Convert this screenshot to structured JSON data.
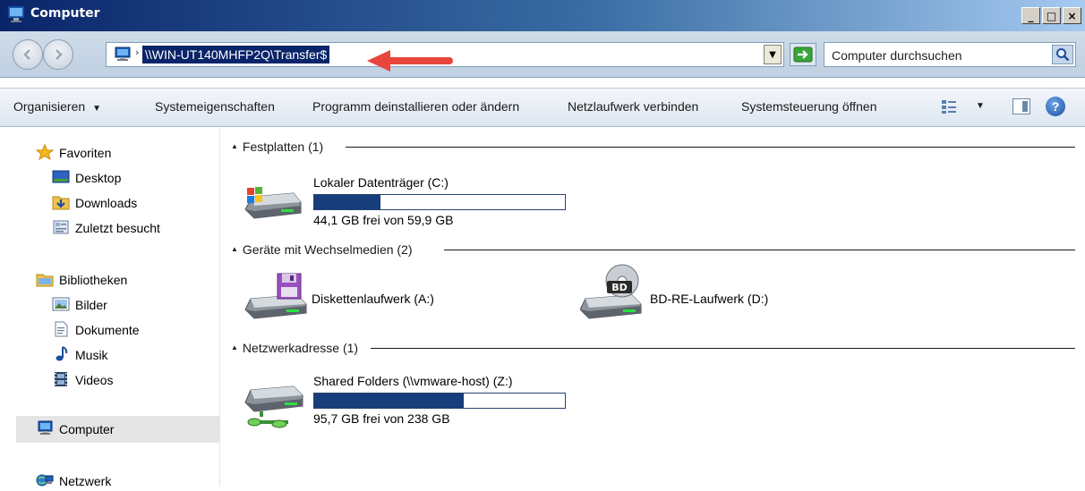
{
  "window": {
    "title": "Computer",
    "buttons": {
      "minimize": "_",
      "maximize": "□",
      "close": "×"
    }
  },
  "address": {
    "path": "\\\\WIN-UT140MHFP2Q\\Transfer$",
    "search_placeholder": "Computer durchsuchen"
  },
  "toolbar": {
    "organize": "Organisieren",
    "system_properties": "Systemeigenschaften",
    "uninstall": "Programm deinstallieren oder ändern",
    "map_drive": "Netzlaufwerk verbinden",
    "control_panel": "Systemsteuerung öffnen"
  },
  "nav": {
    "favorites": "Favoriten",
    "desktop": "Desktop",
    "downloads": "Downloads",
    "recent": "Zuletzt besucht",
    "libraries": "Bibliotheken",
    "pictures": "Bilder",
    "documents": "Dokumente",
    "music": "Musik",
    "videos": "Videos",
    "computer": "Computer",
    "network": "Netzwerk"
  },
  "groups": {
    "hard_drives": "Festplatten (1)",
    "removable": "Geräte mit Wechselmedien (2)",
    "network": "Netzwerkadresse (1)"
  },
  "drives": {
    "c": {
      "name": "Lokaler Datenträger (C:)",
      "info": "44,1 GB frei von 59,9 GB",
      "used_fraction": 0.264
    },
    "a": {
      "name": "Diskettenlaufwerk (A:)"
    },
    "d": {
      "name": "BD-RE-Laufwerk (D:)",
      "badge": "BD"
    },
    "z": {
      "name": "Shared Folders (\\\\vmware-host) (Z:)",
      "info": "95,7 GB frei von 238 GB",
      "used_fraction": 0.598
    }
  },
  "colors": {
    "usage_bar": "#173d7a",
    "title_bar": "#0a246a",
    "arrow": "#e8453c"
  }
}
